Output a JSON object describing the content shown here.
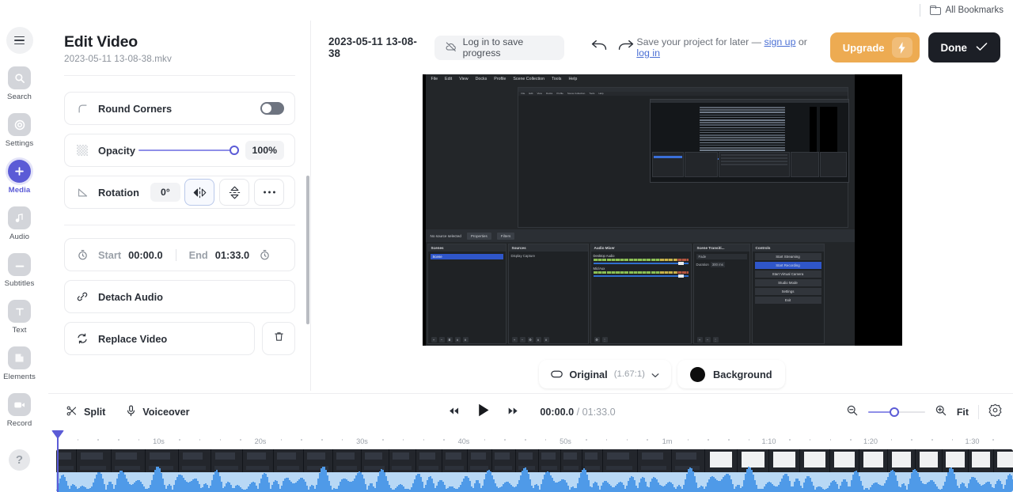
{
  "browser": {
    "bookmarks_label": "All Bookmarks",
    "folder_icon": "folder-icon"
  },
  "rail": {
    "menu_icon": "hamburger-icon",
    "items": [
      {
        "label": "Search",
        "icon": "search-icon",
        "active": false
      },
      {
        "label": "Settings",
        "icon": "gear-icon",
        "active": false
      },
      {
        "label": "Media",
        "icon": "plus-icon",
        "active": true
      },
      {
        "label": "Audio",
        "icon": "music-note-icon",
        "active": false
      },
      {
        "label": "Subtitles",
        "icon": "subtitles-icon",
        "active": false
      },
      {
        "label": "Text",
        "icon": "text-t-icon",
        "active": false
      },
      {
        "label": "Elements",
        "icon": "shapes-icon",
        "active": false
      },
      {
        "label": "Record",
        "icon": "video-camera-icon",
        "active": false
      }
    ],
    "help_label": "?"
  },
  "panel": {
    "title": "Edit Video",
    "subtitle": "2023-05-11 13-08-38.mkv",
    "round_corners": {
      "label": "Round Corners",
      "icon": "round-corner-icon",
      "toggle_on": false
    },
    "opacity": {
      "label": "Opacity",
      "icon": "opacity-icon",
      "value": "100%",
      "percent": 100
    },
    "rotation": {
      "label": "Rotation",
      "icon": "angle-icon",
      "value": "0°",
      "buttons": [
        {
          "name": "flip-horizontal-button",
          "selected": true
        },
        {
          "name": "flip-vertical-button",
          "selected": false
        },
        {
          "name": "more-options-button",
          "selected": false
        }
      ]
    },
    "trim": {
      "start_label": "Start",
      "start_value": "00:00.0",
      "end_label": "End",
      "end_value": "01:33.0",
      "icon": "stopwatch-icon"
    },
    "detach_audio": {
      "label": "Detach Audio",
      "icon": "link-icon"
    },
    "replace_video": {
      "label": "Replace Video",
      "icon": "refresh-icon"
    },
    "delete": {
      "icon": "trash-icon"
    },
    "highlight_color": "#e24a38"
  },
  "toolbar": {
    "project_title": "2023-05-11 13-08-38",
    "login_chip": {
      "label": "Log in to save progress",
      "icon": "cloud-off-icon"
    },
    "undo_icon": "undo-arrow-icon",
    "redo_icon": "redo-arrow-icon",
    "save_prefix": "Save your project for later — ",
    "signup_link": "sign up",
    "save_mid": " or ",
    "login_link": "log in",
    "upgrade_label": "Upgrade",
    "upgrade_icon": "lightning-bolt-icon",
    "upgrade_color": "#edab52",
    "done_label": "Done",
    "done_icon": "check-icon"
  },
  "preview": {
    "obs": {
      "menu": [
        "File",
        "Edit",
        "View",
        "Docks",
        "Profile",
        "Scene Collection",
        "Tools",
        "Help"
      ],
      "status": "No source selected",
      "tabs": [
        "Properties",
        "Filters"
      ],
      "scenes": {
        "title": "Scenes",
        "items": [
          "Scene"
        ]
      },
      "sources": {
        "title": "Sources",
        "items": [
          "Display Capture"
        ]
      },
      "audio_mixer": {
        "title": "Audio Mixer",
        "channels": [
          {
            "name": "Desktop Audio",
            "db": "0.0 dB"
          },
          {
            "name": "Mic/Aux",
            "db": "0.0 dB"
          }
        ]
      },
      "scene_transitions": {
        "title": "Scene Transiti...",
        "mode": "Fade",
        "duration_label": "Duration",
        "duration_value": "300 ms"
      },
      "controls": {
        "title": "Controls",
        "buttons": [
          "Start Streaming",
          "Start Recording",
          "Start Virtual Camera",
          "Studio Mode",
          "Settings",
          "Exit"
        ],
        "active": "Start Recording"
      }
    },
    "ratio": {
      "label": "Original",
      "dims": "(1.67:1)",
      "icon": "rectangle-icon",
      "chevron": "chevron-down-icon"
    },
    "background": {
      "label": "Background",
      "color": "#0d0d0d"
    }
  },
  "timeline_bar": {
    "split": {
      "label": "Split",
      "icon": "scissors-icon"
    },
    "voiceover": {
      "label": "Voiceover",
      "icon": "microphone-icon"
    },
    "rewind_icon": "rewind-icon",
    "play_icon": "play-icon",
    "forward_icon": "fast-forward-icon",
    "current_time": "00:00.0",
    "time_separator": "/",
    "total_time": "01:33.0",
    "zoom_out_icon": "zoom-out-icon",
    "zoom_in_icon": "zoom-in-icon",
    "zoom_percent": 46,
    "fit_label": "Fit",
    "settings_icon": "gear-icon"
  },
  "timeline": {
    "ruler_ticks": [
      "10s",
      "20s",
      "30s",
      "40s",
      "50s",
      "1m",
      "1:10",
      "1:20",
      "1:30"
    ],
    "playhead_time": "00:00.0"
  }
}
